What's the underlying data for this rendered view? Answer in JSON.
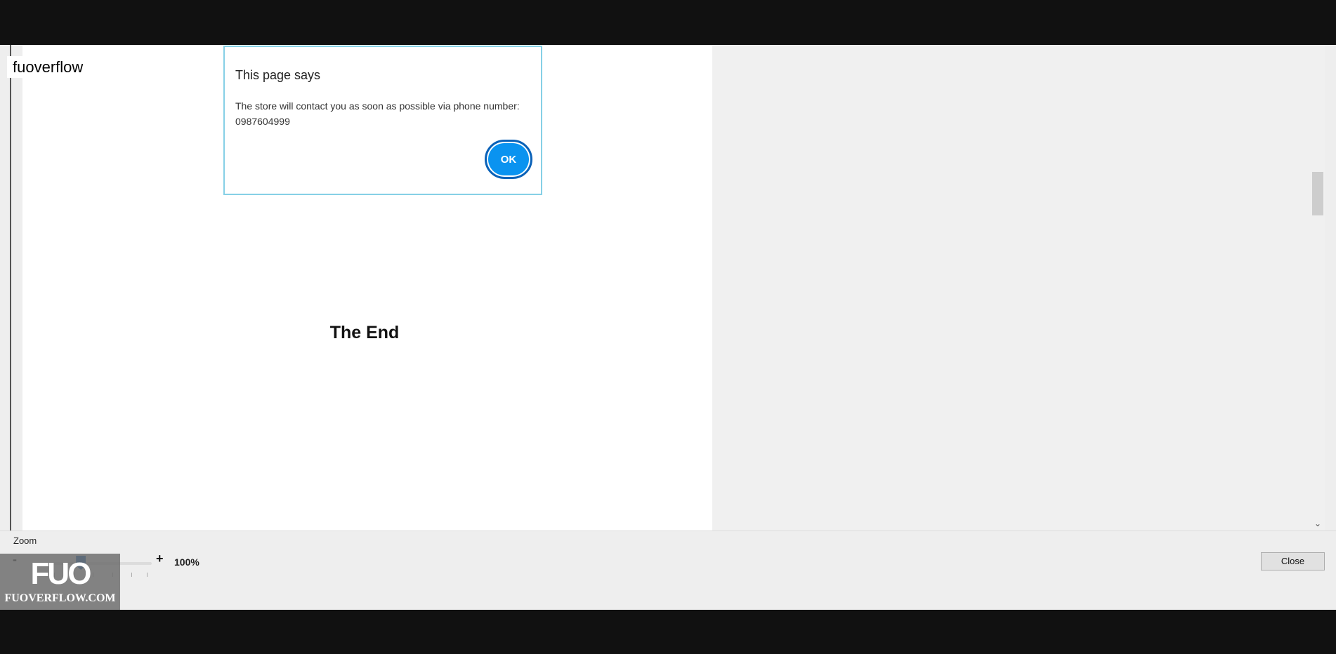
{
  "site_label": "fuoverflow",
  "dialog": {
    "title": "This page says",
    "message": "The store will contact you as soon as possible via phone number: 0987604999",
    "ok_label": "OK"
  },
  "page": {
    "heading": "The End"
  },
  "zoom": {
    "label": "Zoom",
    "minus": "-",
    "plus": "+",
    "value_text": "100%",
    "slider_fraction": 0.4
  },
  "close_label": "Close",
  "watermark": {
    "logo": "FUO",
    "text": "FUOVERFLOW.COM"
  },
  "colors": {
    "ok_button": "#0a93f0",
    "dialog_border": "#86d0e6",
    "slider_thumb": "#0b5eb8"
  },
  "icons": {
    "scroll_down": "chevron-down-icon"
  }
}
